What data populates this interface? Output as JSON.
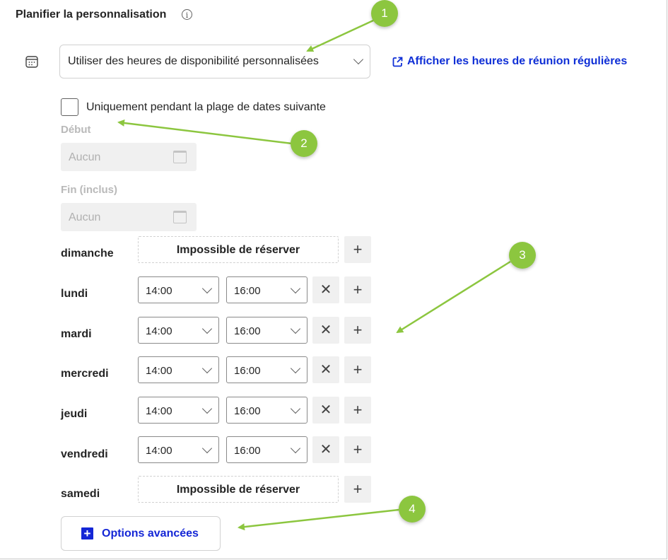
{
  "heading": "Planifier la personnalisation",
  "info_icon": "i",
  "availability": {
    "dropdown_value": "Utiliser des heures de disponibilité personnalisées",
    "link_text": "Afficher les heures de réunion régulières"
  },
  "date_range": {
    "checkbox_label": "Uniquement pendant la plage de dates suivante",
    "checked": false,
    "start_label": "Début",
    "start_placeholder": "Aucun",
    "end_label": "Fin (inclus)",
    "end_placeholder": "Aucun"
  },
  "schedule": {
    "unavailable_text": "Impossible de réserver",
    "days": [
      {
        "name": "dimanche",
        "available": false
      },
      {
        "name": "lundi",
        "available": true,
        "start": "14:00",
        "end": "16:00"
      },
      {
        "name": "mardi",
        "available": true,
        "start": "14:00",
        "end": "16:00"
      },
      {
        "name": "mercredi",
        "available": true,
        "start": "14:00",
        "end": "16:00"
      },
      {
        "name": "jeudi",
        "available": true,
        "start": "14:00",
        "end": "16:00"
      },
      {
        "name": "vendredi",
        "available": true,
        "start": "14:00",
        "end": "16:00"
      },
      {
        "name": "samedi",
        "available": false
      }
    ],
    "add_symbol": "+",
    "remove_symbol": "✕"
  },
  "advanced_options": {
    "label": "Options avancées",
    "icon": "+"
  },
  "annotations": [
    "1",
    "2",
    "3",
    "4"
  ],
  "colors": {
    "link": "#0f2fd6",
    "advanced": "#1426d6",
    "badge": "#8cc63f"
  }
}
